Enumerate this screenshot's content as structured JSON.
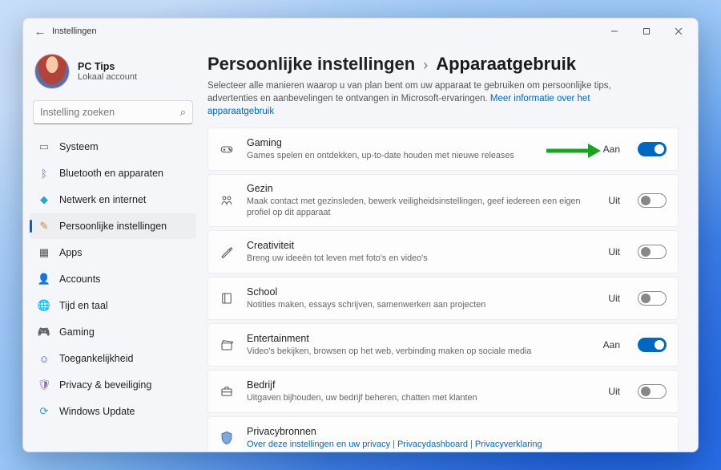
{
  "window": {
    "title": "Instellingen"
  },
  "profile": {
    "name": "PC Tips",
    "sub": "Lokaal account"
  },
  "search": {
    "placeholder": "Instelling zoeken"
  },
  "nav": {
    "system": {
      "label": "Systeem"
    },
    "bt": {
      "label": "Bluetooth en apparaten"
    },
    "net": {
      "label": "Netwerk en internet"
    },
    "pers": {
      "label": "Persoonlijke instellingen"
    },
    "apps": {
      "label": "Apps"
    },
    "acc": {
      "label": "Accounts"
    },
    "time": {
      "label": "Tijd en taal"
    },
    "gaming": {
      "label": "Gaming"
    },
    "access": {
      "label": "Toegankelijkheid"
    },
    "priv": {
      "label": "Privacy & beveiliging"
    },
    "wu": {
      "label": "Windows Update"
    }
  },
  "breadcrumb": {
    "parent": "Persoonlijke instellingen",
    "sep": "›",
    "current": "Apparaatgebruik"
  },
  "description": {
    "text": "Selecteer alle manieren waarop u van plan bent om uw apparaat te gebruiken om persoonlijke tips, advertenties en aanbevelingen te ontvangen in Microsoft-ervaringen. ",
    "link": "Meer informatie over het apparaatgebruik"
  },
  "states": {
    "on": "Aan",
    "off": "Uit"
  },
  "cards": {
    "gaming": {
      "title": "Gaming",
      "sub": "Games spelen en ontdekken, up-to-date houden met nieuwe releases",
      "state": "Aan",
      "on": true
    },
    "gezin": {
      "title": "Gezin",
      "sub": "Maak contact met gezinsleden, bewerk veiligheidsinstellingen, geef iedereen een eigen profiel op dit apparaat",
      "state": "Uit",
      "on": false
    },
    "creat": {
      "title": "Creativiteit",
      "sub": "Breng uw ideeën tot leven met foto's en video's",
      "state": "Uit",
      "on": false
    },
    "school": {
      "title": "School",
      "sub": "Notities maken, essays schrijven, samenwerken aan projecten",
      "state": "Uit",
      "on": false
    },
    "ent": {
      "title": "Entertainment",
      "sub": "Video's bekijken, browsen op het web, verbinding maken op sociale media",
      "state": "Aan",
      "on": true
    },
    "bedrijf": {
      "title": "Bedrijf",
      "sub": "Uitgaven bijhouden, uw bedrijf beheren, chatten met klanten",
      "state": "Uit",
      "on": false
    },
    "privacy": {
      "title": "Privacybronnen",
      "link1": "Over deze instellingen en uw privacy",
      "link2": "Privacydashboard",
      "link3": "Privacyverklaring",
      "sep": " | "
    }
  }
}
